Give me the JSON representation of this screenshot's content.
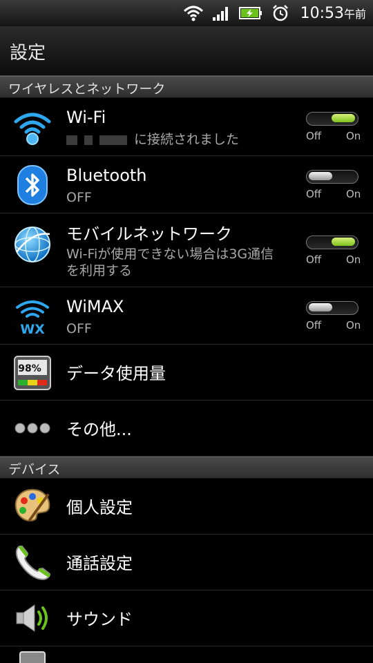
{
  "status_bar": {
    "time": "10:53",
    "ampm": "午前",
    "icons": [
      "wifi-icon",
      "signal-icon",
      "battery-charging-icon",
      "alarm-icon"
    ]
  },
  "title_bar": {
    "title": "設定"
  },
  "sections": {
    "wireless": "ワイヤレスとネットワーク",
    "device": "デバイス"
  },
  "rows": {
    "wifi": {
      "label": "Wi-Fi",
      "sub": "に接続されました",
      "toggle": "on",
      "off_label": "Off",
      "on_label": "On"
    },
    "bluetooth": {
      "label": "Bluetooth",
      "sub": "OFF",
      "toggle": "off",
      "off_label": "Off",
      "on_label": "On"
    },
    "mobile": {
      "label": "モバイルネットワーク",
      "sub_line1": "Wi-Fiが使用できない場合は3G通信",
      "sub_line2": "を利用する",
      "toggle": "on",
      "off_label": "Off",
      "on_label": "On"
    },
    "wimax": {
      "label": "WiMAX",
      "sub": "OFF",
      "toggle": "off",
      "off_label": "Off",
      "on_label": "On",
      "icon_text": "WX"
    },
    "data_usage": {
      "label": "データ使用量",
      "icon_text": "98%"
    },
    "other": {
      "label": "その他..."
    },
    "personalize": {
      "label": "個人設定"
    },
    "call": {
      "label": "通話設定"
    },
    "sound": {
      "label": "サウンド"
    }
  },
  "colors": {
    "accent_green": "#7cc21d",
    "wifi_blue": "#2ea7ee"
  }
}
